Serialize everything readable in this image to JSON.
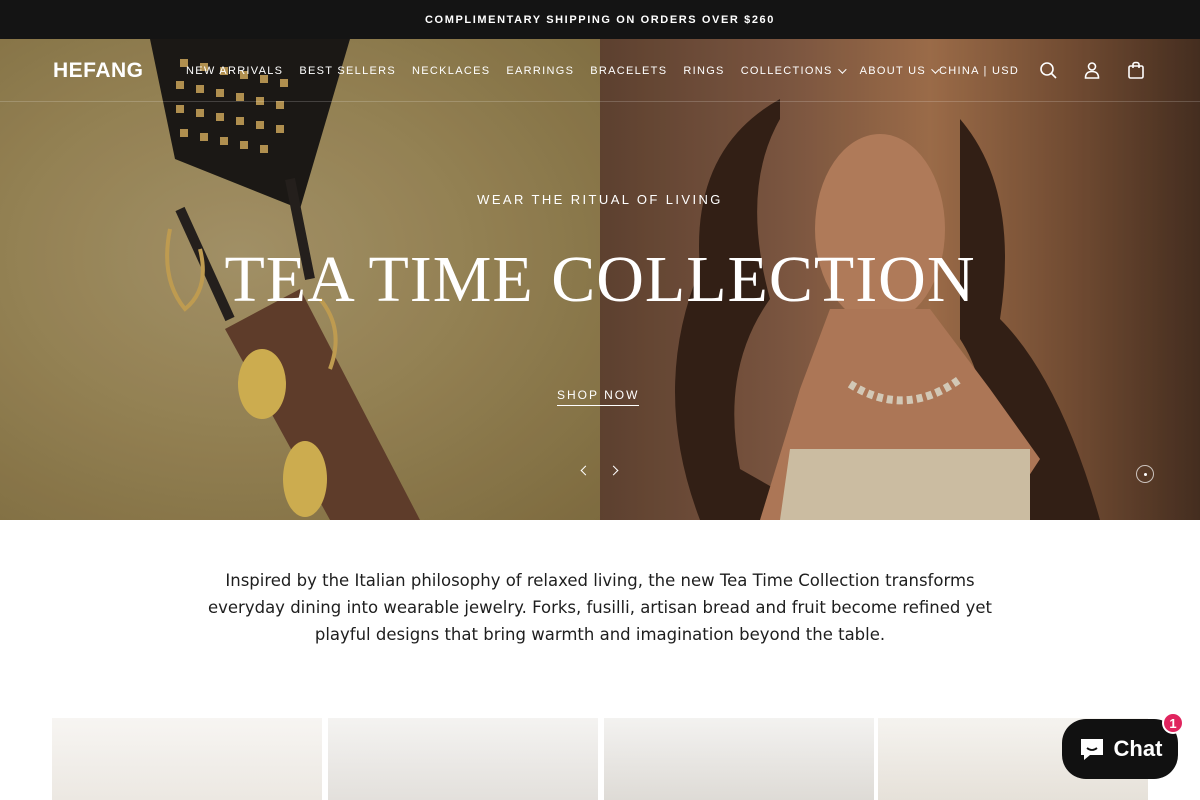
{
  "announcement": {
    "text": "COMPLIMENTARY SHIPPING ON ORDERS OVER $260"
  },
  "header": {
    "logo": "HEFANG",
    "nav": [
      {
        "label": "NEW ARRIVALS"
      },
      {
        "label": "BEST SELLERS"
      },
      {
        "label": "NECKLACES"
      },
      {
        "label": "EARRINGS"
      },
      {
        "label": "BRACELETS"
      },
      {
        "label": "RINGS"
      },
      {
        "label": "COLLECTIONS"
      },
      {
        "label": "ABOUT US"
      }
    ],
    "locale": "CHINA | USD",
    "icons": [
      "search-icon",
      "account-icon",
      "bag-icon"
    ]
  },
  "hero": {
    "eyebrow": "WEAR THE RITUAL OF LIVING",
    "title": "TEA TIME COLLECTION",
    "cta": "SHOP NOW"
  },
  "intro": {
    "text": "Inspired by the Italian philosophy of relaxed living, the new Tea Time Collection transforms everyday dining into wearable jewelry. Forks, fusilli, artisan bread and fruit become refined yet playful designs that bring warmth and imagination beyond the table."
  },
  "chat": {
    "label": "Chat",
    "unread": "1"
  },
  "colors": {
    "announcement_bg": "#141414",
    "chat_bg": "#111111",
    "badge": "#e0245e"
  }
}
